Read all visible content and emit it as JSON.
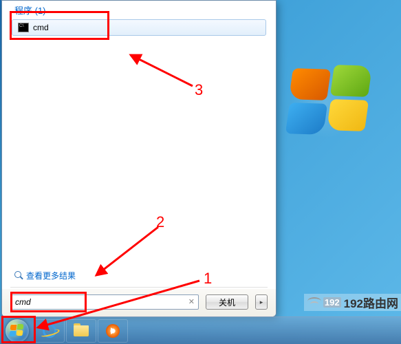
{
  "start_menu": {
    "programs_header": "程序 (1)",
    "result_label": "cmd",
    "see_more_label": "查看更多结果",
    "search_value": "cmd",
    "shutdown_label": "关机"
  },
  "watermark": {
    "ip": "192",
    "text": "192路由网"
  },
  "annotations": {
    "n1": "1",
    "n2": "2",
    "n3": "3"
  }
}
